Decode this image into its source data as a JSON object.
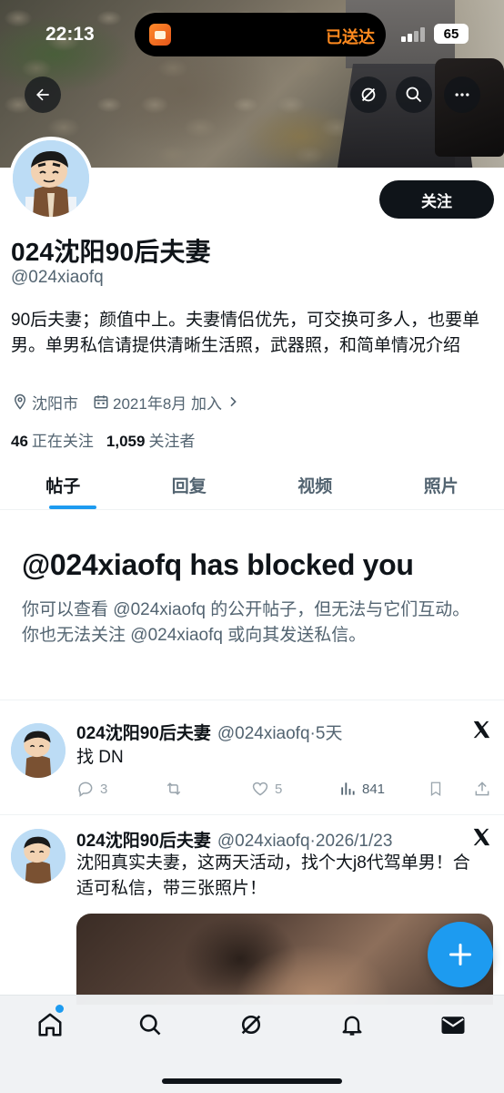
{
  "status_bar": {
    "time": "22:13",
    "island_text": "已送达",
    "battery": "65"
  },
  "profile": {
    "display_name": "024沈阳90后夫妻",
    "handle": "@024xiaofq",
    "follow_button": "关注",
    "bio": "90后夫妻；颜值中上。夫妻情侣优先，可交换可多人，也要单男。单男私信请提供清晰生活照，武器照，和简单情况介绍",
    "location": "沈阳市",
    "joined": "2021年8月 加入",
    "following_count": "46",
    "following_label": "正在关注",
    "followers_count": "1,059",
    "followers_label": "关注者"
  },
  "tabs": [
    {
      "label": "帖子",
      "active": true
    },
    {
      "label": "回复",
      "active": false
    },
    {
      "label": "视频",
      "active": false
    },
    {
      "label": "照片",
      "active": false
    }
  ],
  "blocked": {
    "title": "@024xiaofq has blocked you",
    "description": "你可以查看 @024xiaofq 的公开帖子，但无法与它们互动。你也无法关注 @024xiaofq 或向其发送私信。"
  },
  "posts": [
    {
      "name": "024沈阳90后夫妻",
      "handle": "@024xiaofq",
      "dot": "·",
      "time": "5天",
      "text": "找 DN",
      "replies": "3",
      "retweets": "",
      "likes": "5",
      "views": "841"
    },
    {
      "name": "024沈阳90后夫妻",
      "handle": "@024xiaofq",
      "dot": "·",
      "time": "2026/1/23",
      "text": "沈阳真实夫妻，这两天活动，找个大j8代驾单男！合适可私信，带三张照片！"
    }
  ],
  "colors": {
    "accent": "#1d9bf0",
    "text_primary": "#0f1419",
    "text_secondary": "#536471",
    "island_text": "#ff8a1f"
  },
  "icons": {
    "banner": [
      "back-arrow-icon",
      "grok-icon",
      "search-icon",
      "more-icon"
    ],
    "meta": [
      "location-icon",
      "calendar-icon",
      "chevron-right-icon"
    ],
    "actions": [
      "reply-icon",
      "retweet-icon",
      "like-icon",
      "views-icon",
      "bookmark-icon",
      "share-icon"
    ],
    "nav": [
      "home-icon",
      "search-icon",
      "grok-icon",
      "notifications-icon",
      "messages-icon"
    ]
  }
}
